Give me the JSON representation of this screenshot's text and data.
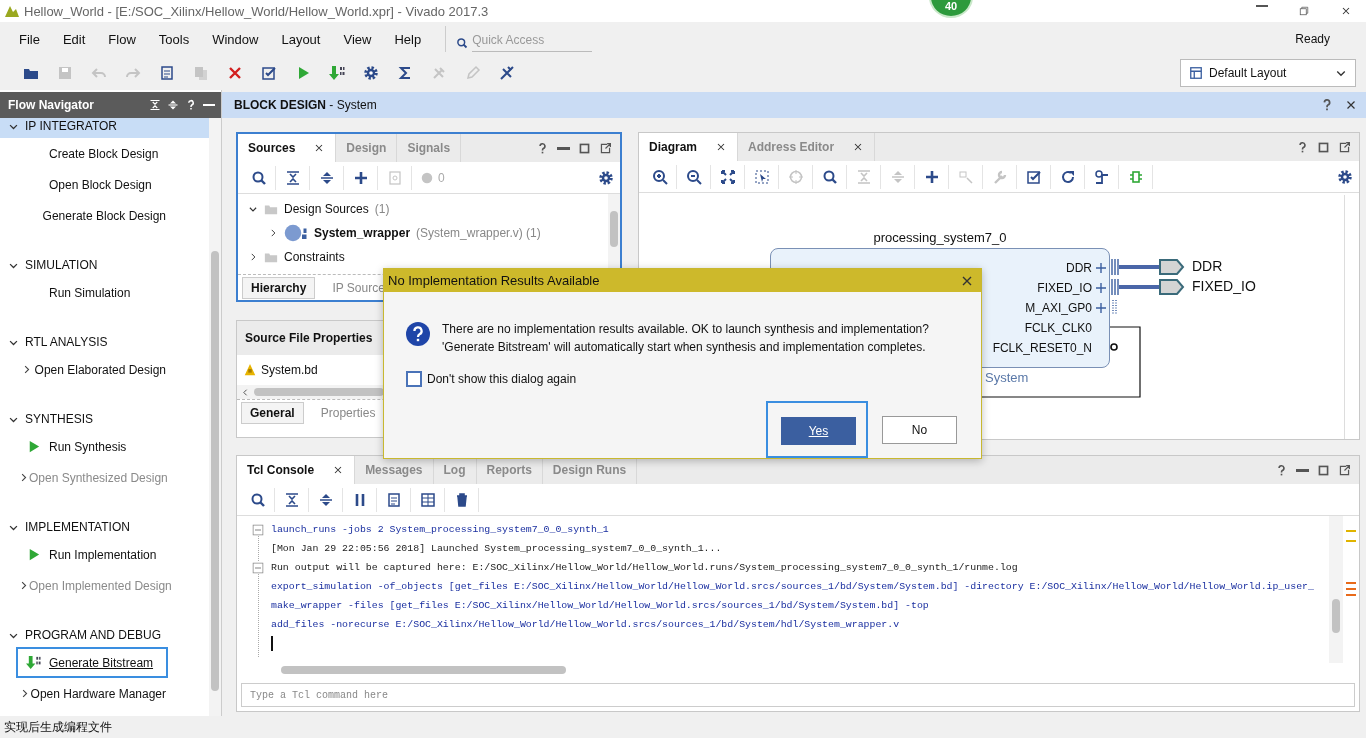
{
  "window": {
    "title": "Hellow_World - [E:/SOC_Xilinx/Hellow_World/Hellow_World.xpr] - Vivado 2017.3",
    "badge": "40"
  },
  "menu": [
    "File",
    "Edit",
    "Flow",
    "Tools",
    "Window",
    "Layout",
    "View",
    "Help"
  ],
  "quick_access": {
    "placeholder": "Quick Access"
  },
  "run_status": "Ready",
  "toolbar": [
    {
      "kind": "folder",
      "disabled": false
    },
    {
      "kind": "save",
      "disabled": true
    },
    {
      "kind": "undo",
      "disabled": true
    },
    {
      "kind": "redo",
      "disabled": true
    },
    {
      "kind": "document",
      "disabled": false
    },
    {
      "kind": "copy",
      "disabled": true
    },
    {
      "kind": "cross",
      "disabled": false
    },
    {
      "kind": "check",
      "disabled": false
    },
    {
      "kind": "play",
      "disabled": false
    },
    {
      "kind": "bitstream",
      "disabled": false
    },
    {
      "kind": "gear",
      "disabled": false
    },
    {
      "kind": "sigma",
      "disabled": false
    },
    {
      "kind": "tool",
      "disabled": true
    },
    {
      "kind": "pencil",
      "disabled": true
    },
    {
      "kind": "toolcross",
      "disabled": false
    }
  ],
  "layout_select": {
    "value": "Default Layout"
  },
  "flow_navigator": {
    "title": "Flow Navigator",
    "sections": [
      {
        "title": "IP INTEGRATOR",
        "selected": true,
        "items": [
          {
            "label": "Create Block Design",
            "kind": "plain",
            "disabled": false,
            "focused": false
          },
          {
            "label": "Open Block Design",
            "kind": "plain",
            "disabled": false,
            "focused": false
          },
          {
            "label": "Generate Block Design",
            "kind": "plain",
            "disabled": false,
            "focused": false
          }
        ]
      },
      {
        "title": "SIMULATION",
        "selected": false,
        "items": [
          {
            "label": "Run Simulation",
            "kind": "plain",
            "disabled": false,
            "focused": false
          }
        ]
      },
      {
        "title": "RTL ANALYSIS",
        "selected": false,
        "items": [
          {
            "label": "Open Elaborated Design",
            "kind": "expand",
            "disabled": false,
            "focused": false
          }
        ]
      },
      {
        "title": "SYNTHESIS",
        "selected": false,
        "items": [
          {
            "label": "Run Synthesis",
            "kind": "run",
            "disabled": false,
            "focused": false
          },
          {
            "label": "Open Synthesized Design",
            "kind": "expand",
            "disabled": true,
            "focused": false
          }
        ]
      },
      {
        "title": "IMPLEMENTATION",
        "selected": false,
        "items": [
          {
            "label": "Run Implementation",
            "kind": "run",
            "disabled": false,
            "focused": false
          },
          {
            "label": "Open Implemented Design",
            "kind": "expand",
            "disabled": true,
            "focused": false
          }
        ]
      },
      {
        "title": "PROGRAM AND DEBUG",
        "selected": false,
        "items": [
          {
            "label": "Generate Bitstream",
            "kind": "bitstream",
            "disabled": false,
            "focused": true
          },
          {
            "label": "Open Hardware Manager",
            "kind": "expand",
            "disabled": false,
            "focused": false
          }
        ]
      }
    ]
  },
  "block_design": {
    "title": "**BLOCK DESIGN** - System"
  },
  "sources": {
    "tabs": [
      {
        "label": "Sources",
        "selected": true
      },
      {
        "label": "Design",
        "selected": false
      },
      {
        "label": "Signals",
        "selected": false
      }
    ],
    "toolbar": [
      {
        "kind": "search",
        "disabled": false
      },
      {
        "kind": "collapse",
        "disabled": false
      },
      {
        "kind": "expand",
        "disabled": false
      },
      {
        "kind": "add",
        "disabled": false
      },
      {
        "kind": "helpdoc",
        "disabled": true
      }
    ],
    "count": "0",
    "tree": [
      {
        "label": "Design Sources",
        "detail": "(1)",
        "expanded": true,
        "children": [
          {
            "label": "System_wrapper",
            "detail": "(System_wrapper.v) (1)",
            "expanded": false
          }
        ]
      },
      {
        "label": "Constraints",
        "expanded": false
      }
    ],
    "bottom_tabs": [
      {
        "label": "Hierarchy",
        "selected": true
      },
      {
        "label": "IP Source",
        "selected": false
      }
    ]
  },
  "properties": {
    "title": "Source File Properties",
    "file": "System.bd",
    "bottom_tabs": [
      {
        "label": "General",
        "selected": true
      },
      {
        "label": "Properties",
        "selected": false
      }
    ]
  },
  "diagram": {
    "tabs": [
      {
        "label": "Diagram",
        "selected": true
      },
      {
        "label": "Address Editor",
        "selected": false
      }
    ],
    "toolbar": [
      {
        "kind": "zoomin",
        "disabled": false
      },
      {
        "kind": "zoomout",
        "disabled": false
      },
      {
        "kind": "fit",
        "disabled": false
      },
      {
        "kind": "select",
        "disabled": false
      },
      {
        "kind": "target",
        "disabled": true
      },
      {
        "kind": "search",
        "disabled": false
      },
      {
        "kind": "collapse",
        "disabled": true
      },
      {
        "kind": "expand",
        "disabled": true
      },
      {
        "kind": "add",
        "disabled": false
      },
      {
        "kind": "route",
        "disabled": true
      },
      {
        "kind": "wrench",
        "disabled": true
      },
      {
        "kind": "check",
        "disabled": false
      },
      {
        "kind": "refresh",
        "disabled": false
      },
      {
        "kind": "regenerate",
        "disabled": false
      },
      {
        "kind": "validate",
        "disabled": false
      }
    ],
    "block": {
      "title": "processing_system7_0",
      "subtitle": "System",
      "pins": [
        {
          "name": "DDR",
          "kind": "bus"
        },
        {
          "name": "FIXED_IO",
          "kind": "bus"
        },
        {
          "name": "M_AXI_GP0",
          "kind": "axi"
        },
        {
          "name": "FCLK_CLK0",
          "kind": "clock"
        },
        {
          "name": "FCLK_RESET0_N",
          "kind": "reset"
        }
      ]
    },
    "ports": [
      "DDR",
      "FIXED_IO"
    ]
  },
  "tcl": {
    "tabs": [
      {
        "label": "Tcl Console",
        "selected": true
      },
      {
        "label": "Messages",
        "selected": false
      },
      {
        "label": "Log",
        "selected": false
      },
      {
        "label": "Reports",
        "selected": false
      },
      {
        "label": "Design Runs",
        "selected": false
      }
    ],
    "toolbar": [
      {
        "kind": "search",
        "disabled": false
      },
      {
        "kind": "collapse",
        "disabled": false
      },
      {
        "kind": "expand",
        "disabled": false
      },
      {
        "kind": "pause",
        "disabled": false
      },
      {
        "kind": "document",
        "disabled": false
      },
      {
        "kind": "columns",
        "disabled": false
      },
      {
        "kind": "trash",
        "disabled": false
      }
    ],
    "lines": [
      {
        "text": "launch_runs -jobs 2 System_processing_system7_0_0_synth_1",
        "kind": "command",
        "fold": true
      },
      {
        "text": "[Mon Jan 29 22:05:56 2018] Launched System_processing_system7_0_0_synth_1...",
        "kind": "output",
        "fold": false
      },
      {
        "text": "Run output will be captured here: E:/SOC_Xilinx/Hellow_World/Hellow_World.runs/System_processing_system7_0_0_synth_1/runme.log",
        "kind": "output",
        "fold": true
      },
      {
        "text": "export_simulation -of_objects [get_files E:/SOC_Xilinx/Hellow_World/Hellow_World.srcs/sources_1/bd/System/System.bd] -directory E:/SOC_Xilinx/Hellow_World/Hellow_World.ip_user_",
        "kind": "command",
        "fold": false
      },
      {
        "text": "make_wrapper -files [get_files E:/SOC_Xilinx/Hellow_World/Hellow_World.srcs/sources_1/bd/System/System.bd] -top",
        "kind": "command",
        "fold": false
      },
      {
        "text": "add_files -norecurse E:/SOC_Xilinx/Hellow_World/Hellow_World.srcs/sources_1/bd/System/hdl/System_wrapper.v",
        "kind": "command",
        "fold": false
      }
    ],
    "input": {
      "placeholder": "Type a Tcl command here"
    }
  },
  "dialog": {
    "title": "No Implementation Results Available",
    "message": [
      "There are no implementation results available. OK to launch synthesis and implementation?",
      "'Generate Bitstream' will automatically start when synthesis and implementation completes."
    ],
    "checkbox": {
      "label": "Don't show this dialog again",
      "checked": false
    },
    "buttons": [
      {
        "label": "Yes",
        "kind": "primary",
        "focused": true
      },
      {
        "label": "No",
        "kind": "secondary",
        "focused": false
      }
    ]
  },
  "status_bar": "实现后生成编程文件"
}
